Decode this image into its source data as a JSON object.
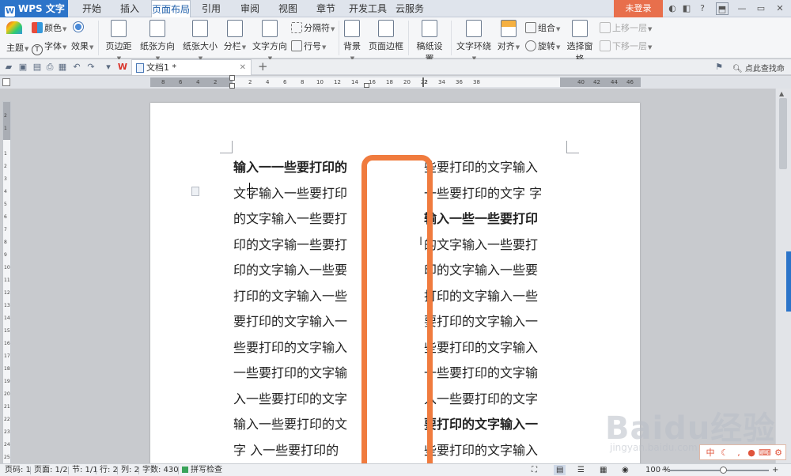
{
  "app": {
    "name": "WPS 文字",
    "logo": "W"
  },
  "menu": {
    "tabs": [
      "开始",
      "插入",
      "页面布局",
      "引用",
      "审阅",
      "视图",
      "章节",
      "开发工具",
      "云服务"
    ],
    "active": 2,
    "login_label": "未登录"
  },
  "ribbon": {
    "theme_label": "主题",
    "color_label": "颜色",
    "font_label": "字体",
    "effect_label": "效果",
    "margins_label": "页边距",
    "orientation_label": "纸张方向",
    "size_label": "纸张大小",
    "columns_label": "分栏",
    "text_direction_label": "文字方向",
    "separator_label": "分隔符",
    "line_number_label": "行号",
    "background_label": "背景",
    "page_border_label": "页面边框",
    "draft_label": "稿纸设置",
    "wrap_label": "文字环绕",
    "align_label": "对齐",
    "group_label": "组合",
    "rotate_label": "旋转",
    "selection_pane_label": "选择窗格",
    "bring_forward_label": "上移一层",
    "send_backward_label": "下移一层"
  },
  "document_tab": {
    "title": "文档1 *"
  },
  "find_command": "点此查找命令",
  "ruler": {
    "left_numbers": [
      "8",
      "6",
      "4",
      "2"
    ],
    "numbers": [
      "2",
      "4",
      "6",
      "8",
      "10",
      "12",
      "14",
      "16",
      "18",
      "20",
      "22"
    ],
    "right_numbers": [
      "2",
      "34",
      "36",
      "38",
      "40",
      "42",
      "44",
      "46"
    ],
    "vertical_numbers": [
      "2",
      "1",
      "1",
      "2",
      "3",
      "4",
      "5",
      "6",
      "7",
      "8",
      "9",
      "10",
      "11",
      "12",
      "13",
      "14",
      "15",
      "16",
      "17",
      "18",
      "19",
      "20",
      "21",
      "22",
      "23",
      "24",
      "25"
    ]
  },
  "document": {
    "left_column": [
      "输入一一些要打印的",
      "文字输入一些要打印",
      "的文字输入一些要打",
      "印的文字输一些要打",
      "印的文字输入一些要",
      "打印的文字输入一些",
      "要打印的文字输入一",
      "些要打印的文字输入",
      "一些要打印的文字输",
      "入一些要打印的文字",
      "输入一些要打印的文",
      "字 入一些要打印的"
    ],
    "right_column": [
      "些要打印的文字输入",
      "一些要打印的文字 字",
      "输入一些一些要打印",
      "的文字输入一些要打",
      "印的文字输入一些要",
      "打印的文字输入一些",
      "要打印的文字输入一",
      "些要打印的文字输入",
      "一些要打印的文字输",
      "入一些要打印的文字",
      "要打印的文字输入一",
      "些要打印的文字输入"
    ]
  },
  "status": {
    "page_code": "页码: 1",
    "pages": "页面: 1/2",
    "section": "节: 1/1",
    "row": "行: 2",
    "column": "列: 2",
    "word_count": "字数: 430",
    "spell_check": "拼写检查",
    "zoom": "100 %"
  },
  "watermark": {
    "text": "Baidu经验",
    "sub": "jingyan.baidu.com"
  },
  "colors": {
    "accent": "#2c74c9",
    "highlight": "#f07b3e",
    "login": "#e86f4c"
  }
}
